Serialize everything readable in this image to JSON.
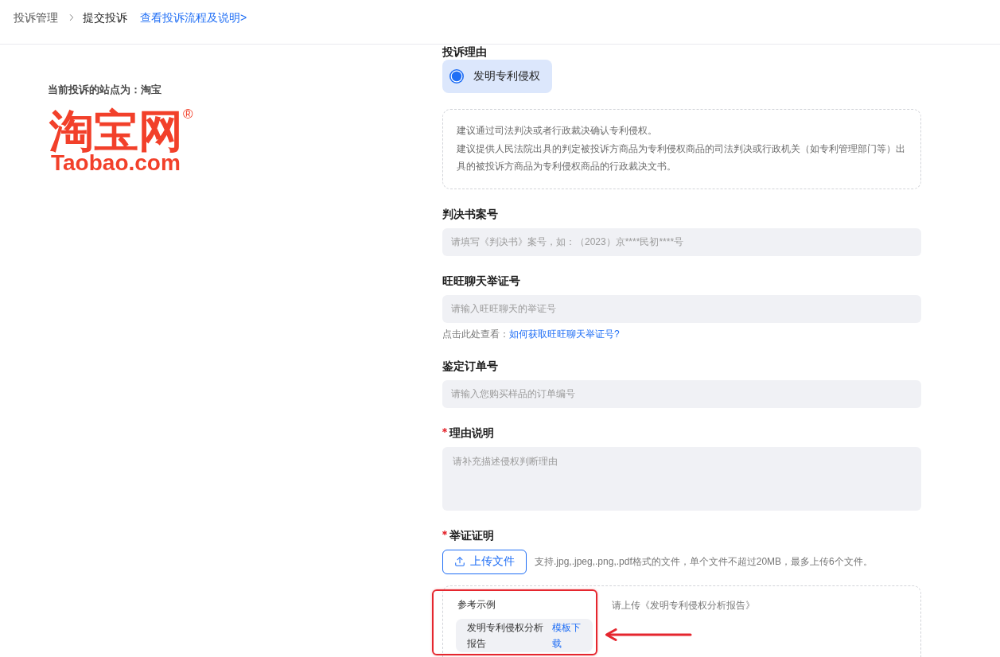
{
  "breadcrumb": {
    "items": [
      {
        "label": "投诉管理",
        "current": false
      },
      {
        "label": "提交投诉",
        "current": true
      }
    ],
    "help_link": "查看投诉流程及说明>"
  },
  "site": {
    "label": "当前投诉的站点为：淘宝",
    "logo": {
      "wordmark": "淘宝网",
      "registered": "®",
      "domain": "Taobao.com"
    }
  },
  "form": {
    "reason": {
      "label": "投诉理由",
      "options": [
        {
          "label": "发明专利侵权",
          "selected": true
        }
      ],
      "note": [
        "建议通过司法判决或者行政裁决确认专利侵权。",
        "建议提供人民法院出具的判定被投诉方商品为专利侵权商品的司法判决或行政机关（如专利管理部门等）出具的被投诉方商品为专利侵权商品的行政裁决文书。"
      ]
    },
    "fields": [
      {
        "kind": "input",
        "label": "判决书案号",
        "required": false,
        "placeholder": "请填写《判决书》案号，如：（2023）京****民初****号"
      },
      {
        "kind": "input",
        "label": "旺旺聊天举证号",
        "required": false,
        "placeholder": "请输入旺旺聊天的举证号",
        "hint": {
          "text": "点击此处查看：",
          "link": "如何获取旺旺聊天举证号?"
        }
      },
      {
        "kind": "input",
        "label": "鉴定订单号",
        "required": false,
        "placeholder": "请输入您购买样品的订单编号"
      },
      {
        "kind": "textarea",
        "label": "理由说明",
        "required": true,
        "placeholder": "请补充描述侵权判断理由"
      },
      {
        "kind": "upload",
        "label": "举证证明",
        "required": true,
        "button": "上传文件",
        "hint": "支持.jpg,.jpeg,.png,.pdf格式的文件，单个文件不超过20MB，最多上传6个文件。",
        "example": {
          "title": "参考示例",
          "file_name": "发明专利侵权分析报告",
          "link": "模板下载",
          "instruction": "请上传《发明专利侵权分析报告》"
        }
      }
    ]
  },
  "annotation": {
    "frame": true,
    "arrow": true
  }
}
